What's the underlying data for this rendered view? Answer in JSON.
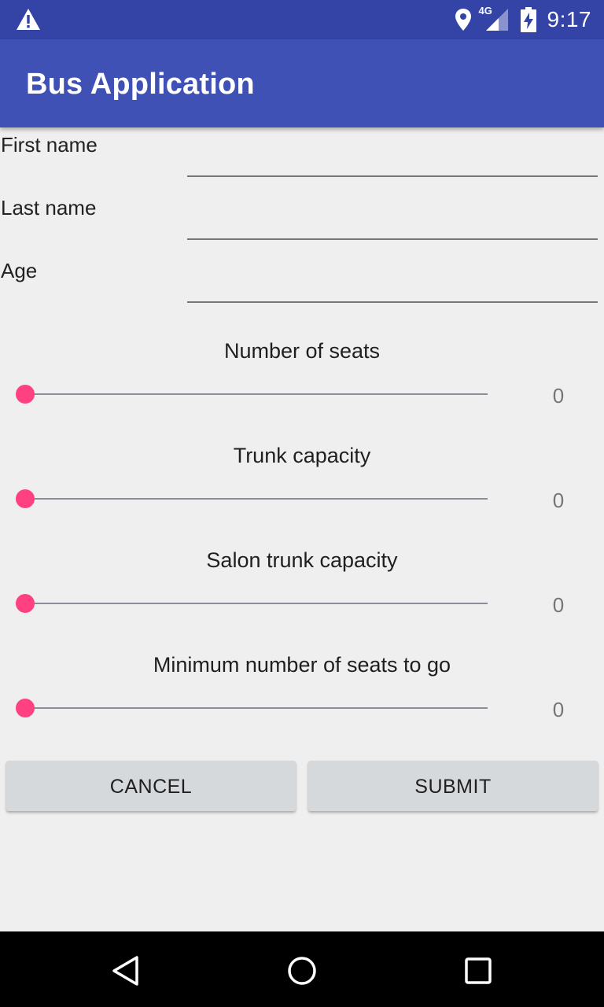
{
  "status_bar": {
    "time": "9:17",
    "network_type": "4G",
    "icons": [
      "warning-icon",
      "location-icon",
      "signal-icon",
      "battery-charging-icon"
    ]
  },
  "app_bar": {
    "title": "Bus Application"
  },
  "form": {
    "fields": [
      {
        "label": "First name",
        "value": "",
        "placeholder": ""
      },
      {
        "label": "Last name",
        "value": "",
        "placeholder": ""
      },
      {
        "label": "Age",
        "value": "",
        "placeholder": ""
      }
    ]
  },
  "sliders": [
    {
      "label": "Number of seats",
      "value": "0",
      "fraction": 0
    },
    {
      "label": "Trunk capacity",
      "value": "0",
      "fraction": 0
    },
    {
      "label": "Salon trunk capacity",
      "value": "0",
      "fraction": 0
    },
    {
      "label": "Minimum number of seats to go",
      "value": "0",
      "fraction": 0
    }
  ],
  "buttons": {
    "cancel": "CANCEL",
    "submit": "SUBMIT"
  },
  "navigation": {
    "icons": [
      "back-icon",
      "home-icon",
      "recents-icon"
    ]
  },
  "colors": {
    "status_bar": "#3344a6",
    "app_bar": "#3f51b5",
    "accent": "#ff4081",
    "background": "#efefef",
    "button": "#d6d9dc",
    "nav_bar": "#000000"
  }
}
